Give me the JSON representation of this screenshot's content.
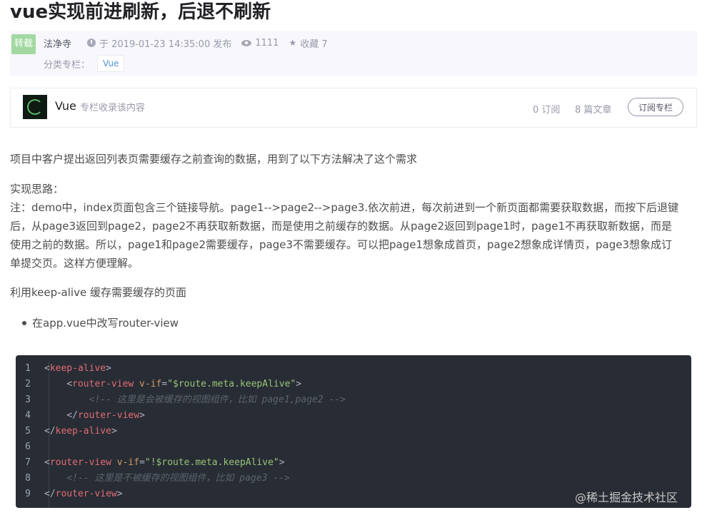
{
  "article": {
    "title": "vue实现前进刷新，后退不刷新",
    "badge": "转载",
    "author": "法净寺",
    "published": "于 2019-01-23 14:35:00 发布",
    "views": "1111",
    "favorites": "收藏 7",
    "category_label": "分类专栏：",
    "category_tag": "Vue"
  },
  "column": {
    "name": "Vue",
    "desc": "专栏收录该内容",
    "subscribers": "0 订阅",
    "articles": "8 篇文章",
    "subscribe_button": "订阅专栏"
  },
  "content": {
    "intro": "项目中客户提出返回列表页需要缓存之前查询的数据，用到了以下方法解决了这个需求",
    "idea_title": "实现思路：",
    "note_lines": [
      "注：demo中，index页面包含三个链接导航。page1-->page2-->page3.依次前进，每次前进到一个新页面都需要获取数据，而按下后退键",
      "后，从page3返回到page2，page2不再获取新数据，而是使用之前缓存的数据。从page2返回到page1时，page1不再获取新数据，而是",
      "使用之前的数据。所以，page1和page2需要缓存，page3不需要缓存。可以把page1想象成首页，page2想象成详情页，page3想象成订",
      "单提交页。这样方便理解。"
    ],
    "keepalive_text": "利用keep-alive 缓存需要缓存的页面",
    "bullet": "在app.vue中改写router-view"
  },
  "code": {
    "line_numbers": [
      "1",
      "2",
      "3",
      "4",
      "5",
      "6",
      "7",
      "8",
      "9"
    ],
    "l1": {
      "open": "<",
      "tag": "keep-alive",
      "close": ">"
    },
    "l2": {
      "indent": "    ",
      "open": "<",
      "tag": "router-view",
      "attr": " v-if",
      "eq": "=",
      "val": "\"$route.meta.keepAlive\"",
      "close": ">"
    },
    "l3": {
      "indent": "        ",
      "comment": "<!-- 这里是会被缓存的视图组件，比如 page1,page2 -->"
    },
    "l4": {
      "indent": "    ",
      "open": "</",
      "tag": "router-view",
      "close": ">"
    },
    "l5": {
      "open": "</",
      "tag": "keep-alive",
      "close": ">"
    },
    "l7": {
      "open": "<",
      "tag": "router-view",
      "attr": " v-if",
      "eq": "=",
      "val": "\"!$route.meta.keepAlive\"",
      "close": ">"
    },
    "l8": {
      "indent": "    ",
      "comment": "<!-- 这里是不被缓存的视图组件，比如 page3 -->"
    },
    "l9": {
      "open": "</",
      "tag": "router-view",
      "close": ">"
    }
  },
  "watermark": "@稀土掘金技术社区"
}
